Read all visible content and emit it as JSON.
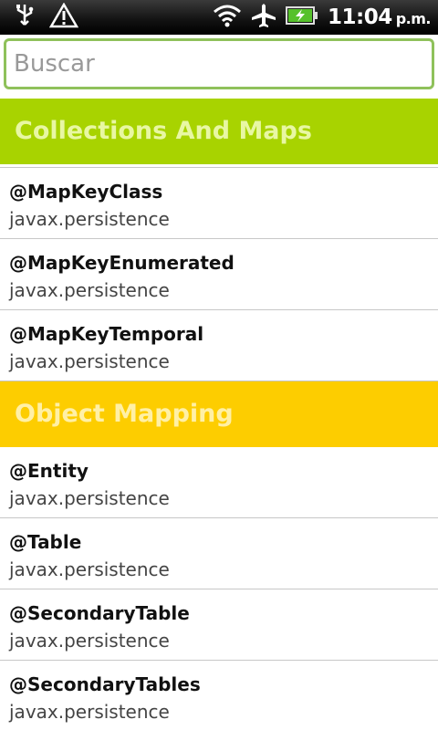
{
  "status": {
    "time": "11:04",
    "ampm": "p.m."
  },
  "search": {
    "placeholder": "Buscar"
  },
  "sections": [
    {
      "title": "Collections And Maps",
      "color": "#a8d300",
      "items": [
        {
          "name": "@MapKeyClass",
          "package": "javax.persistence"
        },
        {
          "name": "@MapKeyEnumerated",
          "package": "javax.persistence"
        },
        {
          "name": "@MapKeyTemporal",
          "package": "javax.persistence"
        }
      ]
    },
    {
      "title": "Object Mapping",
      "color": "#fdcd00",
      "items": [
        {
          "name": "@Entity",
          "package": "javax.persistence"
        },
        {
          "name": "@Table",
          "package": "javax.persistence"
        },
        {
          "name": "@SecondaryTable",
          "package": "javax.persistence"
        },
        {
          "name": "@SecondaryTables",
          "package": "javax.persistence"
        }
      ]
    }
  ]
}
